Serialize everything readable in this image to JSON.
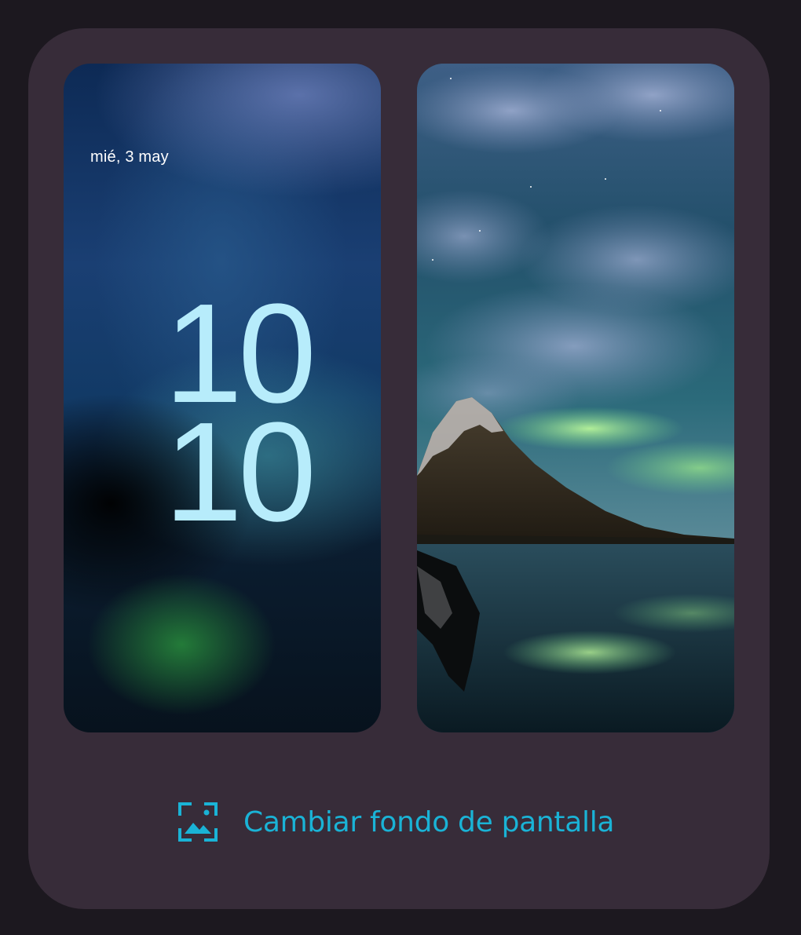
{
  "lock_preview": {
    "date": "mié, 3 may",
    "clock_hours": "10",
    "clock_minutes": "10"
  },
  "home_preview": {
    "scene": "mountain-aurora-wallpaper"
  },
  "action": {
    "label": "Cambiar fondo de pantalla",
    "icon": "wallpaper-icon"
  },
  "colors": {
    "page_background": "#1c181f",
    "card_background": "#372c39",
    "accent": "#1ab3d6",
    "clock": "#b7ecfb"
  }
}
